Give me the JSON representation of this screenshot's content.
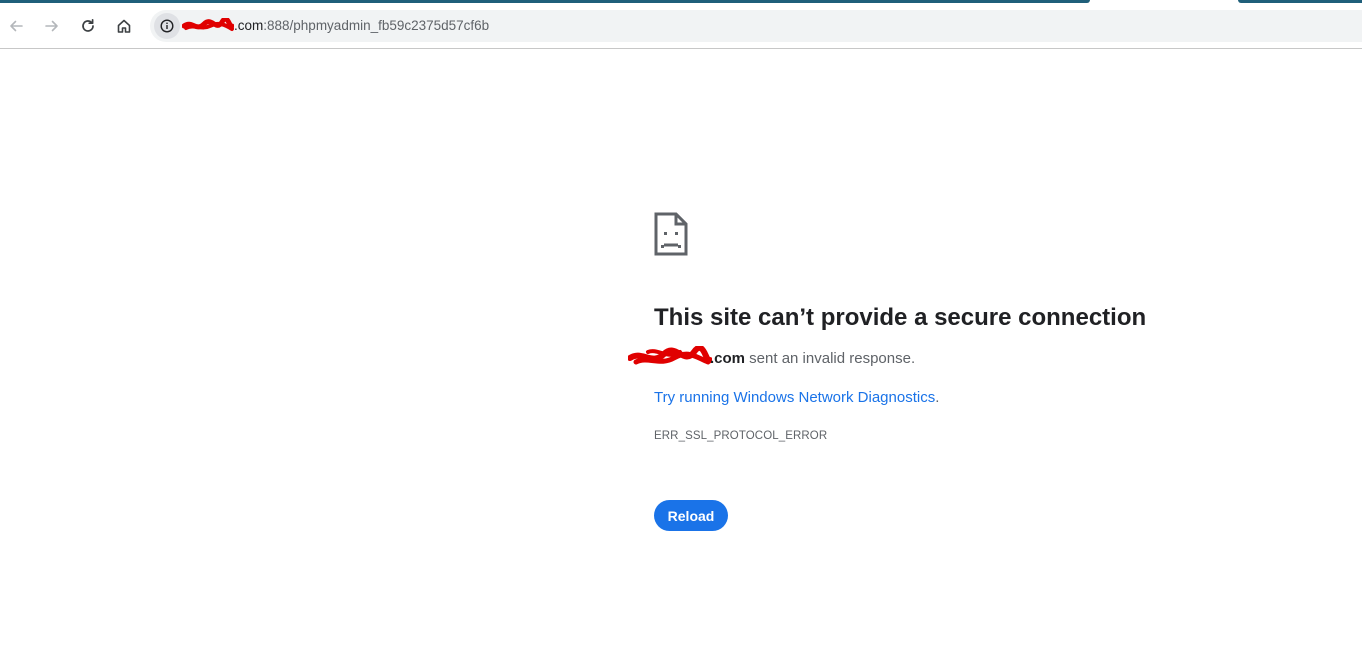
{
  "browser": {
    "url_host_suffix": ".com",
    "url_rest": ":888/phpmyadmin_fb59c2375d57cf6b",
    "icons": {
      "back": "arrow-left-icon",
      "forward": "arrow-right-icon",
      "reload": "reload-icon",
      "home": "home-icon",
      "site_info": "info-icon"
    },
    "accent_color": "#1f5f7a"
  },
  "error_page": {
    "icon": "sad-page-icon",
    "headline": "This site can’t provide a secure connection",
    "host_suffix": ".com",
    "message": " sent an invalid response.",
    "diagnostics_link": "Try running Windows Network Diagnostics",
    "diagnostics_period": ".",
    "error_code": "ERR_SSL_PROTOCOL_ERROR",
    "reload_label": "Reload",
    "button_color": "#1a73e8"
  }
}
